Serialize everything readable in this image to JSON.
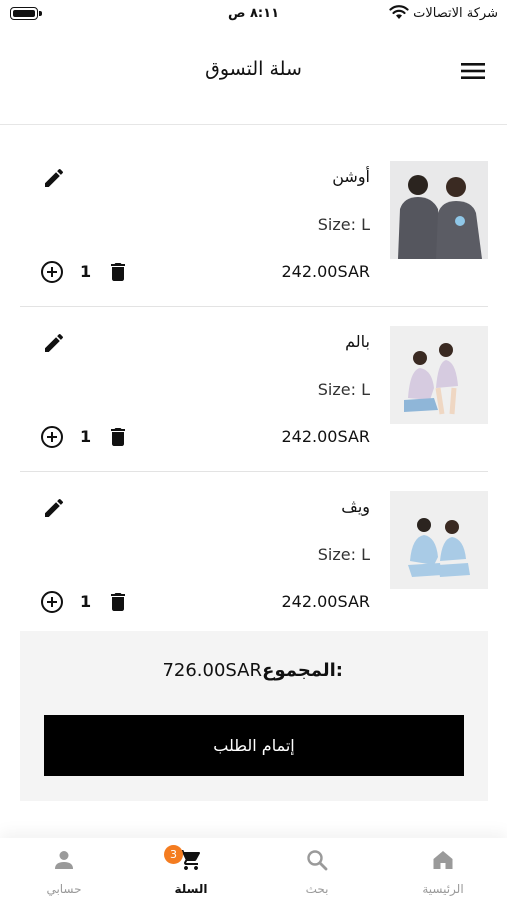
{
  "status_bar": {
    "time": "٨:١١ ص",
    "carrier": "شركة الاتصالات"
  },
  "header": {
    "title": "سلة التسوق"
  },
  "cart": {
    "items": [
      {
        "name": "أوشن",
        "size": "Size: L",
        "price": "242.00SAR",
        "quantity": "1"
      },
      {
        "name": "بالم",
        "size": "Size: L",
        "price": "242.00SAR",
        "quantity": "1"
      },
      {
        "name": "ويڤ",
        "size": "Size: L",
        "price": "242.00SAR",
        "quantity": "1"
      }
    ]
  },
  "summary": {
    "total_label": "المجموع:",
    "total_value": "726.00SAR",
    "checkout_label": "إتمام الطلب"
  },
  "tab_bar": {
    "home": "الرئيسية",
    "search": "بحث",
    "cart": "السلة",
    "account": "حسابي",
    "cart_badge": "3",
    "active_tab": "cart"
  },
  "colors": {
    "badge": "#f47c20",
    "checkout_bg": "#000000",
    "summary_bg": "#f4f4f4",
    "inactive_tab": "#9a9a9a"
  },
  "icons": {
    "menu": "hamburger-menu-icon",
    "edit": "pencil-edit-icon",
    "increase": "plus-circle-icon",
    "delete": "trash-icon",
    "home": "home-icon",
    "search": "search-icon",
    "cart": "cart-icon",
    "account": "person-icon"
  }
}
